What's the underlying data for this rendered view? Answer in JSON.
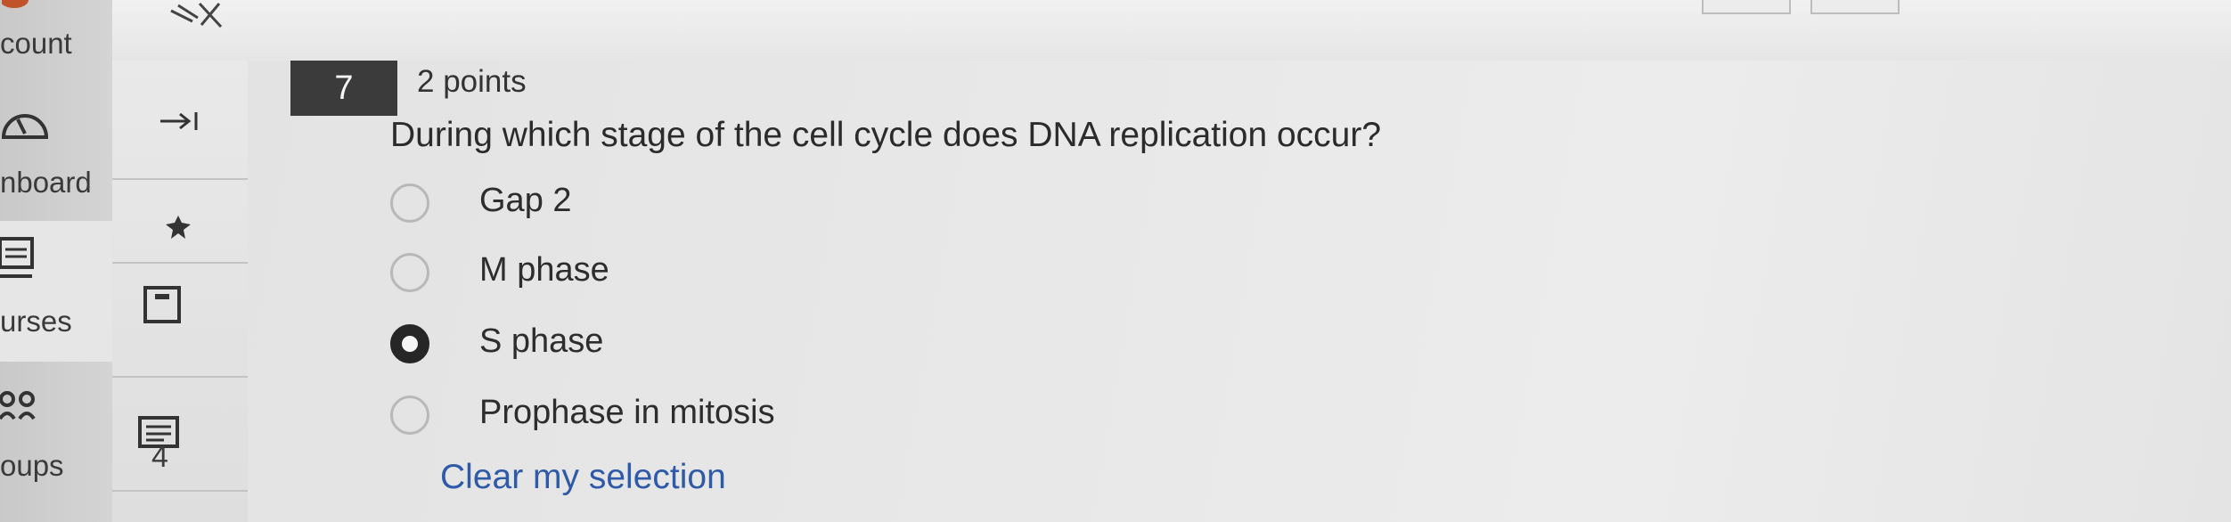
{
  "global_nav": {
    "items": [
      {
        "label": "count",
        "icon": "account-icon"
      },
      {
        "label": "nboard",
        "icon": "dashboard-icon"
      },
      {
        "label": "urses",
        "icon": "courses-icon"
      },
      {
        "label": "oups",
        "icon": "groups-icon"
      }
    ]
  },
  "course_nav": {
    "badge_text": "4"
  },
  "question": {
    "number": "7",
    "points": "2 points",
    "text": "During which stage of the cell cycle does DNA replication occur?",
    "options": [
      {
        "label": "Gap 2",
        "selected": false
      },
      {
        "label": "M phase",
        "selected": false
      },
      {
        "label": "S phase",
        "selected": true
      },
      {
        "label": "Prophase in mitosis",
        "selected": false
      }
    ],
    "clear_label": "Clear my selection"
  },
  "colors": {
    "number_badge_bg": "#3b3b3b",
    "link": "#2e5aa8",
    "selected_radio": "#262626"
  }
}
